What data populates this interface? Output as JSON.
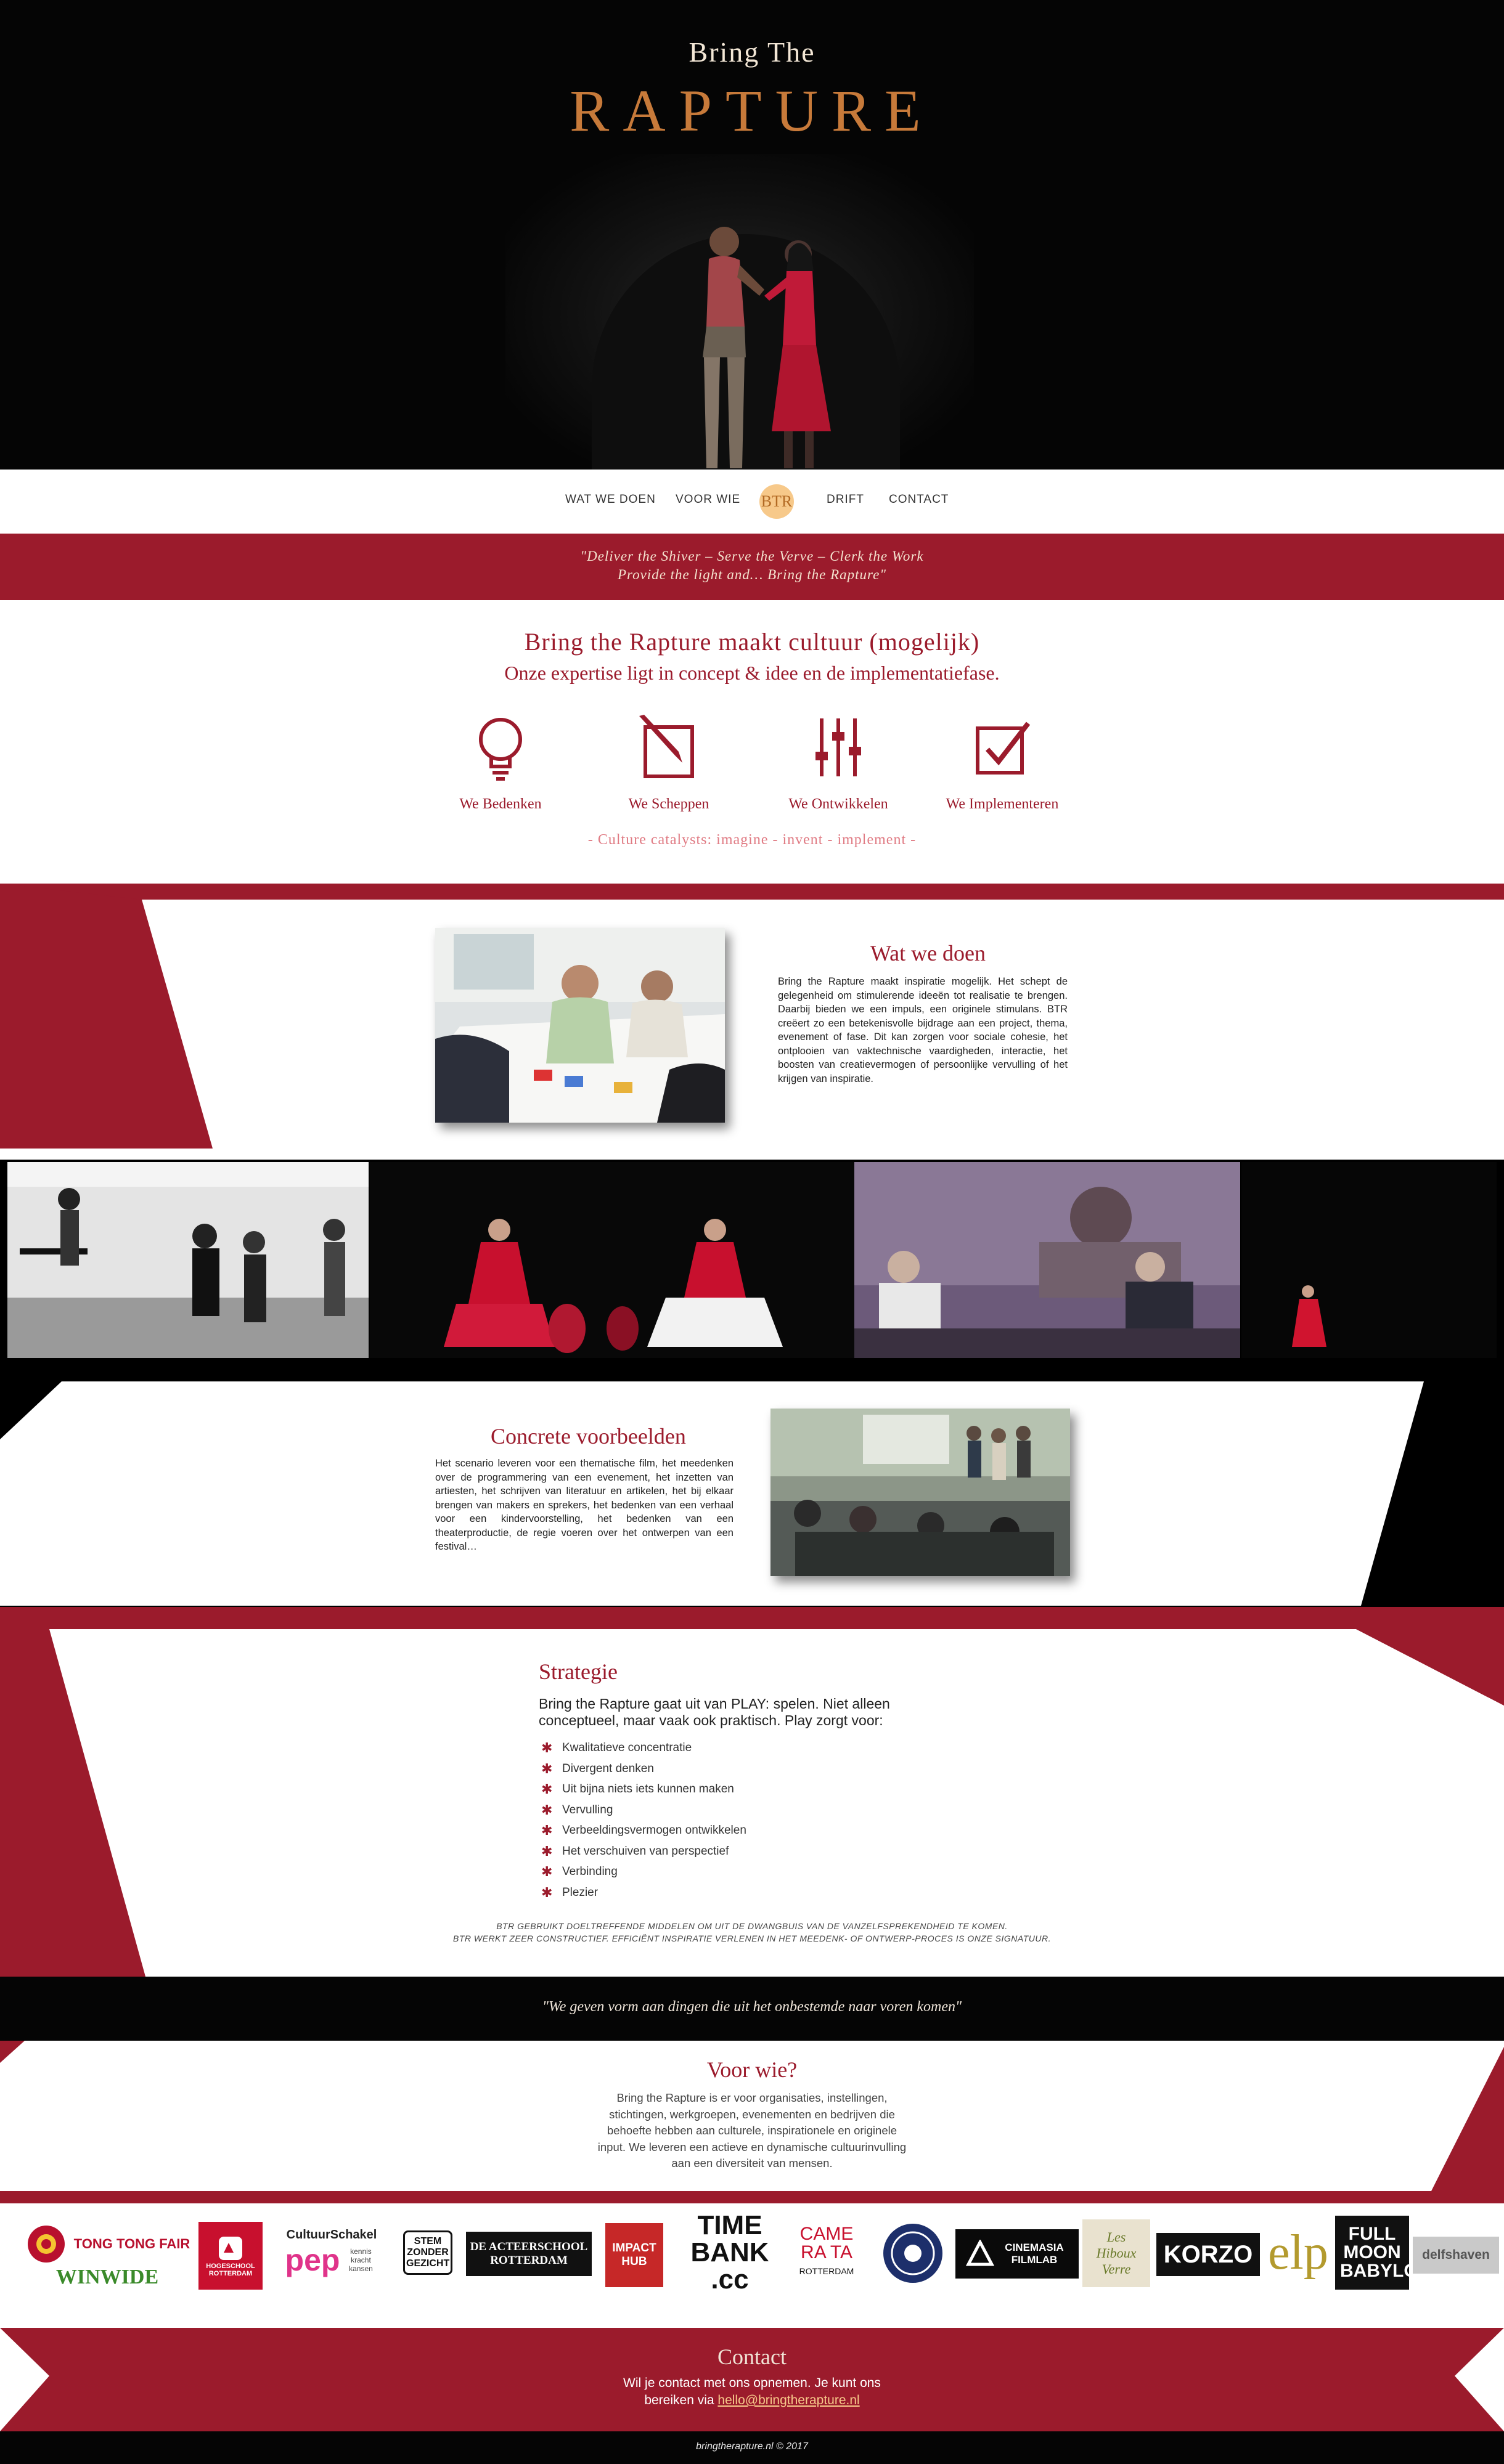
{
  "hero": {
    "brand_small": "Bring The",
    "brand_big": "RAPTURE"
  },
  "nav": {
    "items": [
      "WAT WE DOEN",
      "VOOR WIE",
      "DRIFT",
      "CONTACT"
    ],
    "logo_text": "BTR"
  },
  "quote_band": {
    "line1": "\"Deliver the Shiver – Serve the Verve – Clerk the Work",
    "line2": "Provide the light and… Bring the Rapture\""
  },
  "intro": {
    "title": "Bring the Rapture maakt cultuur (mogelijk)",
    "subtitle": "Onze expertise ligt in concept & idee en de implementatiefase.",
    "services": [
      {
        "label": "We Bedenken",
        "icon": "lightbulb-icon"
      },
      {
        "label": "We Scheppen",
        "icon": "pencil-square-icon"
      },
      {
        "label": "We Ontwikkelen",
        "icon": "sliders-icon"
      },
      {
        "label": "We Implementeren",
        "icon": "checkbox-icon"
      }
    ],
    "tagline": "- Culture catalysts: imagine - invent - implement -"
  },
  "wat_we_doen": {
    "title": "Wat we doen",
    "body": "Bring the Rapture maakt inspiratie mogelijk. Het schept de gelegenheid om stimulerende ideeën tot realisatie te brengen. Daarbij bieden we een impuls, een originele stimulans. BTR creëert zo een betekenisvolle bijdrage aan een project, thema, evenement of fase. Dit kan zorgen voor sociale cohesie, het ontplooien van vaktechnische vaardigheden, interactie, het boosten van creatievermogen of persoonlijke vervulling of het krijgen van inspiratie."
  },
  "concrete": {
    "title": "Concrete voorbeelden",
    "body": "Het scenario leveren voor een thematische film, het meedenken over de programmering van een evenement, het inzetten van artiesten, het schrijven van literatuur en artikelen, het bij elkaar brengen van makers en sprekers, het bedenken van een verhaal voor een kindervoorstelling, het bedenken van een theaterproductie, de regie voeren over het ontwerpen van een festival…"
  },
  "strategie": {
    "title": "Strategie",
    "intro": "Bring the Rapture gaat uit van PLAY: spelen. Niet alleen conceptueel, maar vaak ook praktisch. Play zorgt voor:",
    "items": [
      "Kwalitatieve concentratie",
      "Divergent denken",
      "Uit bijna niets iets kunnen maken",
      "Vervulling",
      "Verbeeldingsvermogen ontwikkelen",
      "Het verschuiven van perspectief",
      "Verbinding",
      "Plezier"
    ],
    "note1": "BTR GEBRUIKT DOELTREFFENDE MIDDELEN OM UIT DE DWANGBUIS VAN DE VANZELFSPREKENDHEID TE KOMEN.",
    "note2": "BTR WERKT ZEER CONSTRUCTIEF. EFFICIËNT INSPIRATIE VERLENEN IN HET MEEDENK- OF ONTWERP-PROCES IS ONZE SIGNATUUR."
  },
  "black_quote": "\"We geven vorm aan dingen die uit het onbestemde naar voren komen\"",
  "voor_wie": {
    "title": "Voor wie?",
    "body": "Bring the Rapture is er voor organisaties, instellingen, stichtingen, werkgroepen, evenementen en bedrijven die behoefte hebben aan culturele, inspirationele en originele input. We leveren een actieve en dynamische cultuurinvulling aan een diversiteit van mensen."
  },
  "partners": {
    "tong_tong": "TONG TONG FAIR",
    "winwide": "WINWIDE",
    "hogeschool": "HOGESCHOOL ROTTERDAM",
    "cultuurschakel": "CultuurSchakel",
    "pep": "pep",
    "pep_sub": "kennis kracht kansen",
    "stem": "STEM ZONDER GEZICHT",
    "acteerschool": "DE ACTEERSCHOOL ROTTERDAM",
    "impact": "IMPACT HUB",
    "timebank": "TIME BANK .cc",
    "camerata": "CAME RA TA",
    "camerata_sub": "ROTTERDAM",
    "cinemasia": "CINEMASIA FILMLAB",
    "hiboux": "Les Hiboux Verre",
    "korzo": "KORZO",
    "elp": "elp",
    "fullmoon": "FULL MOON BABYLON",
    "delfshaven": "delfshaven"
  },
  "contact": {
    "title": "Contact",
    "line1": "Wil je contact met ons opnemen. Je kunt ons",
    "line2_prefix": "bereiken via",
    "email": "hello@bringtherapture.nl"
  },
  "footer": "bringtherapture.nl © 2017",
  "colors": {
    "brand_red": "#9b1b2c",
    "accent_orange": "#c77a3a",
    "black": "#050505"
  }
}
